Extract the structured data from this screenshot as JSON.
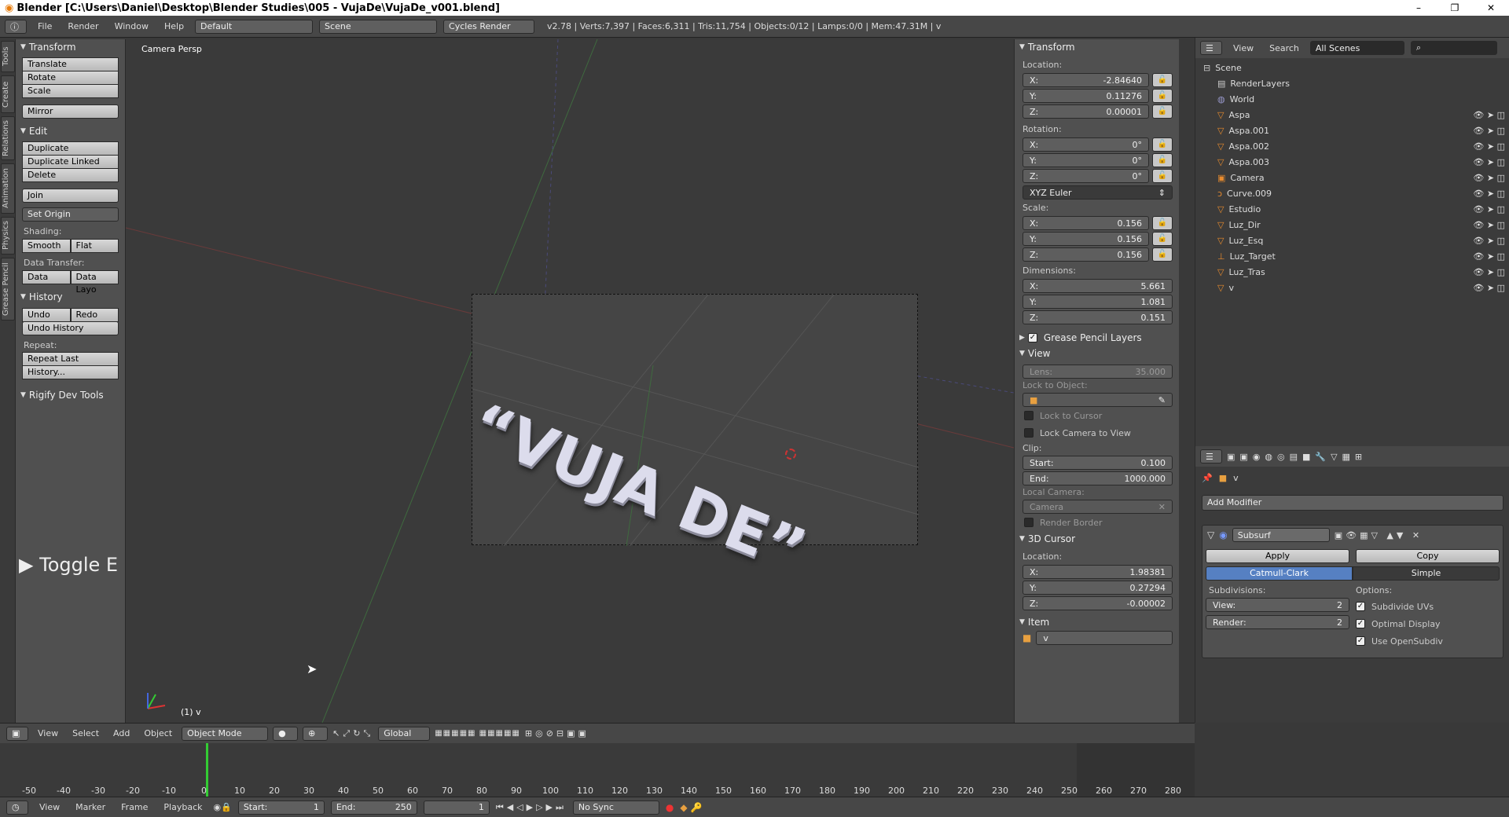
{
  "window": {
    "title": "Blender  [C:\\Users\\Daniel\\Desktop\\Blender Studies\\005 - VujaDe\\VujaDe_v001.blend]",
    "minimize": "–",
    "maximize": "❐",
    "close": "✕"
  },
  "infobar": {
    "menus": [
      "File",
      "Render",
      "Window",
      "Help"
    ],
    "layout": "Default",
    "scene": "Scene",
    "engine": "Cycles Render",
    "stats": "v2.78 | Verts:7,397 | Faces:6,311 | Tris:11,754 | Objects:0/12 | Lamps:0/0 | Mem:47.31M | v"
  },
  "lefttabs": [
    "Tools",
    "Create",
    "Relations",
    "Animation",
    "Physics",
    "Grease Pencil"
  ],
  "tools": {
    "transform": {
      "title": "Transform",
      "buttons": [
        "Translate",
        "Rotate",
        "Scale"
      ],
      "mirror": "Mirror"
    },
    "edit": {
      "title": "Edit",
      "buttons": [
        "Duplicate",
        "Duplicate Linked",
        "Delete"
      ],
      "join": "Join",
      "set_origin": "Set Origin"
    },
    "shading": {
      "label": "Shading:",
      "smooth": "Smooth",
      "flat": "Flat"
    },
    "data_transfer": {
      "label": "Data Transfer:",
      "data": "Data",
      "data_layo": "Data Layo"
    },
    "history": {
      "title": "History",
      "undo": "Undo",
      "redo": "Redo",
      "undo_history": "Undo History",
      "repeat_label": "Repeat:",
      "repeat_last": "Repeat Last",
      "history": "History..."
    },
    "rigify": "Rigify Dev Tools",
    "toggle": "Toggle E"
  },
  "viewport": {
    "label": "Camera Persp",
    "object_label": "(1) v",
    "text3d": "“VUJA DE”"
  },
  "npanel": {
    "transform": "Transform",
    "location_label": "Location:",
    "location": [
      {
        "axis": "X:",
        "value": "-2.84640"
      },
      {
        "axis": "Y:",
        "value": "0.11276"
      },
      {
        "axis": "Z:",
        "value": "0.00001"
      }
    ],
    "rotation_label": "Rotation:",
    "rotation": [
      {
        "axis": "X:",
        "value": "0°"
      },
      {
        "axis": "Y:",
        "value": "0°"
      },
      {
        "axis": "Z:",
        "value": "0°"
      }
    ],
    "rotation_mode": "XYZ Euler",
    "scale_label": "Scale:",
    "scale": [
      {
        "axis": "X:",
        "value": "0.156"
      },
      {
        "axis": "Y:",
        "value": "0.156"
      },
      {
        "axis": "Z:",
        "value": "0.156"
      }
    ],
    "dimensions_label": "Dimensions:",
    "dimensions": [
      {
        "axis": "X:",
        "value": "5.661"
      },
      {
        "axis": "Y:",
        "value": "1.081"
      },
      {
        "axis": "Z:",
        "value": "0.151"
      }
    ],
    "grease_pencil": "Grease Pencil Layers",
    "view": "View",
    "lens_label": "Lens:",
    "lens": "35.000",
    "lock_object": "Lock to Object:",
    "lock_cursor": "Lock to Cursor",
    "lock_camera": "Lock Camera to View",
    "clip_label": "Clip:",
    "clip_start_label": "Start:",
    "clip_start": "0.100",
    "clip_end_label": "End:",
    "clip_end": "1000.000",
    "local_camera_label": "Local Camera:",
    "local_camera": "Camera",
    "render_border": "Render Border",
    "cursor": "3D Cursor",
    "cursor_location_label": "Location:",
    "cursor_location": [
      {
        "axis": "X:",
        "value": "1.98381"
      },
      {
        "axis": "Y:",
        "value": "0.27294"
      },
      {
        "axis": "Z:",
        "value": "-0.00002"
      }
    ],
    "item": "Item",
    "item_name": "v"
  },
  "outliner": {
    "menus": [
      "View",
      "Search"
    ],
    "scenes": "All Scenes",
    "items": [
      "Scene",
      "RenderLayers",
      "World",
      "Aspa",
      "Aspa.001",
      "Aspa.002",
      "Aspa.003",
      "Camera",
      "Curve.009",
      "Estudio",
      "Luz_Dir",
      "Luz_Esq",
      "Luz_Target",
      "Luz_Tras",
      "v"
    ]
  },
  "properties": {
    "object": "v",
    "add_modifier": "Add Modifier",
    "modifier_name": "Subsurf",
    "apply": "Apply",
    "copy": "Copy",
    "catmull": "Catmull-Clark",
    "simple": "Simple",
    "subdivisions_label": "Subdivisions:",
    "view_label": "View:",
    "view_value": "2",
    "render_label": "Render:",
    "render_value": "2",
    "options_label": "Options:",
    "subdivide_uvs": "Subdivide UVs",
    "optimal_display": "Optimal Display",
    "use_opensubdiv": "Use OpenSubdiv"
  },
  "viewheader": {
    "menus": [
      "View",
      "Select",
      "Add",
      "Object"
    ],
    "mode": "Object Mode",
    "orientation": "Global"
  },
  "timeline": {
    "ticks": [
      "-50",
      "-40",
      "-30",
      "-20",
      "-10",
      "0",
      "10",
      "20",
      "30",
      "40",
      "50",
      "60",
      "70",
      "80",
      "90",
      "100",
      "110",
      "120",
      "130",
      "140",
      "150",
      "160",
      "170",
      "180",
      "190",
      "200",
      "210",
      "220",
      "230",
      "240",
      "250",
      "260",
      "270",
      "280"
    ],
    "menus": [
      "View",
      "Marker",
      "Frame",
      "Playback"
    ],
    "start_label": "Start:",
    "start": "1",
    "end_label": "End:",
    "end": "250",
    "current": "1",
    "sync": "No Sync"
  }
}
